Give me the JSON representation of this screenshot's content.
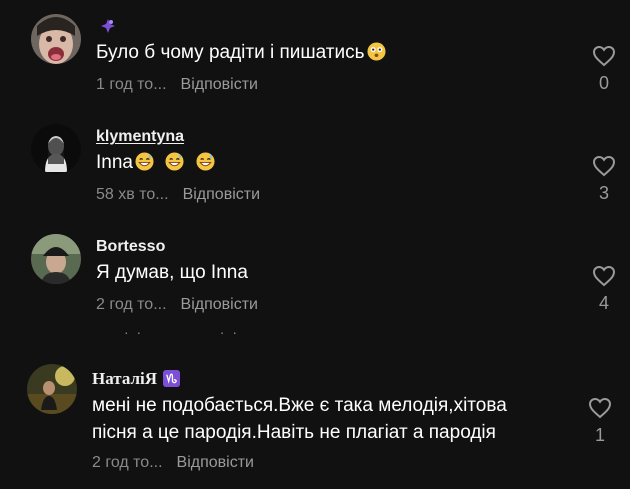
{
  "comments": [
    {
      "username": "",
      "badge": "purple-sparkle",
      "text": "Було б чому радіти і пишатись",
      "emojis": [
        "face-with-open-mouth"
      ],
      "time": "1 год то...",
      "reply": "Відповісти",
      "likes": "0"
    },
    {
      "username": "klymentyna",
      "text": "Inna",
      "emojis": [
        "grinning-sweat",
        "grinning-sweat",
        "grinning-sweat"
      ],
      "time": "58 хв то...",
      "reply": "Відповісти",
      "likes": "3"
    },
    {
      "username": "Bortesso",
      "text": "Я думав, що Inna",
      "emojis": [],
      "time": "2 год то...",
      "reply": "Відповісти",
      "likes": "4"
    },
    {
      "username": "НаталіЯ",
      "badge": "capricorn-sign",
      "text_line1": "мені не подобається.Вже є така мелодія,хітова",
      "text_line2": "пісня а це пародія.Навіть не плагіат а пародія",
      "time": "2 год то...",
      "reply": "Відповісти",
      "likes": "1"
    }
  ],
  "colors": {
    "background": "#111111",
    "text": "#ffffff",
    "muted": "#8a8a8a",
    "badge_purple": "#7b4fd6"
  }
}
